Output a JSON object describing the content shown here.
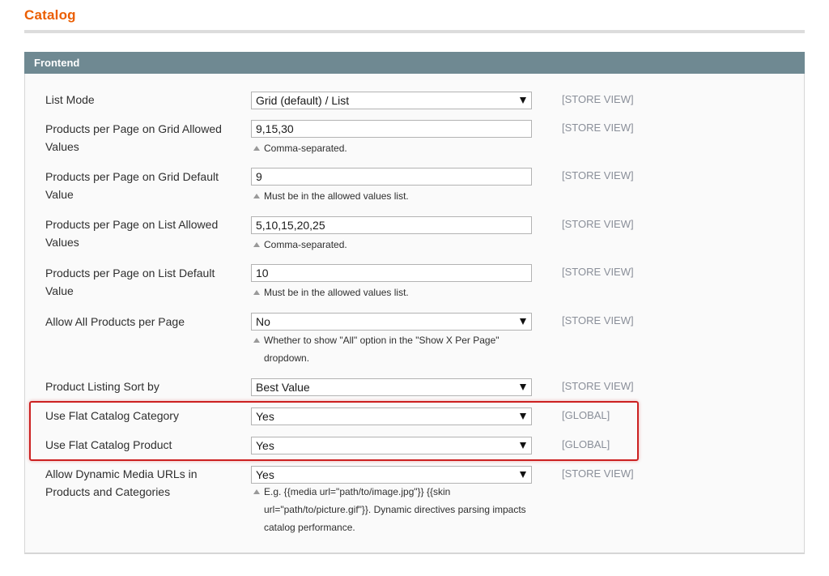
{
  "page": {
    "title": "Catalog"
  },
  "section": {
    "title": "Frontend"
  },
  "fields": {
    "list_mode": {
      "label": "List Mode",
      "value": "Grid (default) / List",
      "scope": "[STORE VIEW]"
    },
    "grid_allowed": {
      "label": "Products per Page on Grid Allowed Values",
      "value": "9,15,30",
      "note": "Comma-separated.",
      "scope": "[STORE VIEW]"
    },
    "grid_default": {
      "label": "Products per Page on Grid Default Value",
      "value": "9",
      "note": "Must be in the allowed values list.",
      "scope": "[STORE VIEW]"
    },
    "list_allowed": {
      "label": "Products per Page on List Allowed Values",
      "value": "5,10,15,20,25",
      "note": "Comma-separated.",
      "scope": "[STORE VIEW]"
    },
    "list_default": {
      "label": "Products per Page on List Default Value",
      "value": "10",
      "note": "Must be in the allowed values list.",
      "scope": "[STORE VIEW]"
    },
    "allow_all": {
      "label": "Allow All Products per Page",
      "value": "No",
      "note": "Whether to show \"All\" option in the \"Show X Per Page\" dropdown.",
      "scope": "[STORE VIEW]"
    },
    "sort_by": {
      "label": "Product Listing Sort by",
      "value": "Best Value",
      "scope": "[STORE VIEW]"
    },
    "flat_category": {
      "label": "Use Flat Catalog Category",
      "value": "Yes",
      "scope": "[GLOBAL]"
    },
    "flat_product": {
      "label": "Use Flat Catalog Product",
      "value": "Yes",
      "scope": "[GLOBAL]"
    },
    "dynamic_media": {
      "label": "Allow Dynamic Media URLs in Products and Categories",
      "value": "Yes",
      "note": "E.g. {{media url=\"path/to/image.jpg\"}} {{skin url=\"path/to/picture.gif\"}}. Dynamic directives parsing impacts catalog performance.",
      "scope": "[STORE VIEW]"
    }
  },
  "colors": {
    "title": "#eb5e00",
    "header_bg": "#6f8992",
    "highlight": "#cc2020",
    "scope_text": "#8a8f99"
  },
  "icons": {
    "select_arrow": "chevron-down-icon",
    "note_marker": "triangle-up-icon"
  }
}
